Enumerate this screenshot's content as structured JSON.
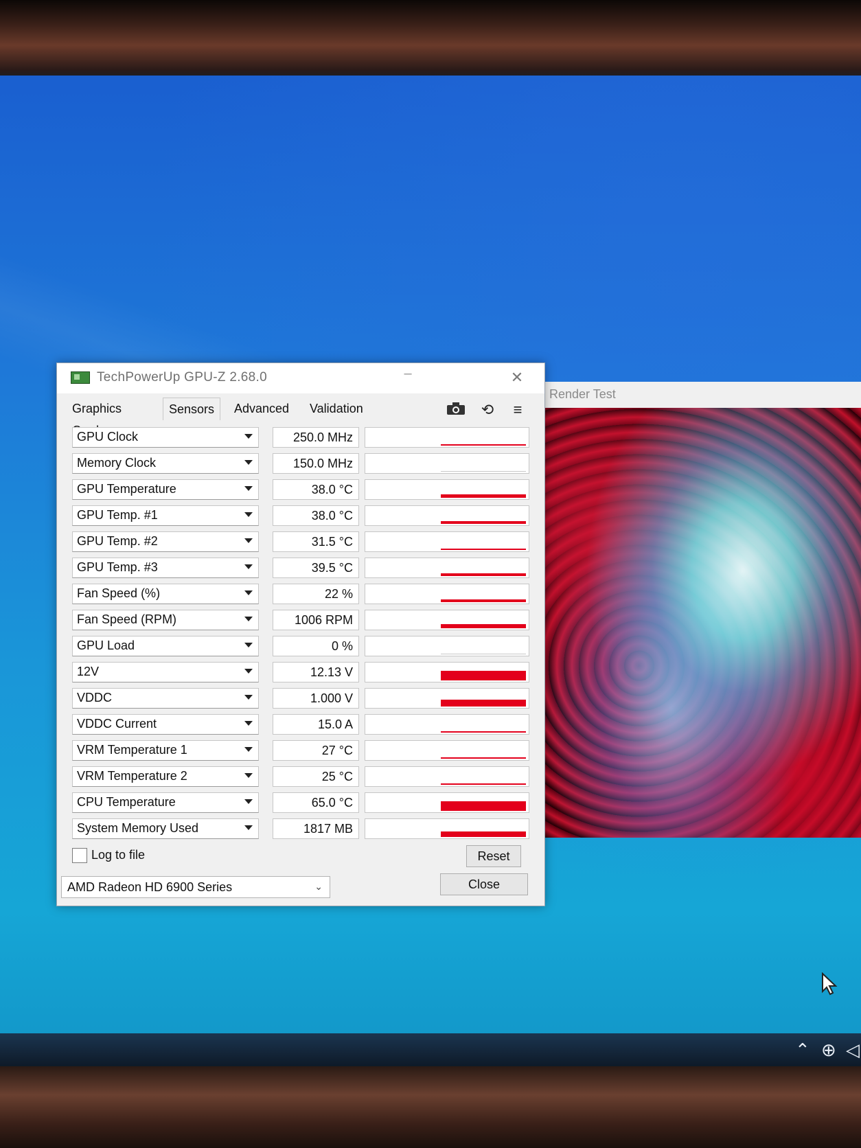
{
  "window": {
    "title": "TechPowerUp GPU-Z 2.68.0",
    "minimize_icon": "minimize-icon",
    "close_icon": "close-icon"
  },
  "tabs": [
    {
      "label": "Graphics Card",
      "active": false
    },
    {
      "label": "Sensors",
      "active": true
    },
    {
      "label": "Advanced",
      "active": false
    },
    {
      "label": "Validation",
      "active": false
    }
  ],
  "toolbar_icons": [
    "camera-icon",
    "refresh-icon",
    "menu-icon"
  ],
  "sensors": [
    {
      "name": "GPU Clock",
      "value": "250.0 MHz",
      "graph_level": 0.05
    },
    {
      "name": "Memory Clock",
      "value": "150.0 MHz",
      "graph_level": 0.0
    },
    {
      "name": "GPU Temperature",
      "value": "38.0 °C",
      "graph_level": 0.2
    },
    {
      "name": "GPU Temp. #1",
      "value": "38.0 °C",
      "graph_level": 0.15
    },
    {
      "name": "GPU Temp. #2",
      "value": "31.5 °C",
      "graph_level": 0.08
    },
    {
      "name": "GPU Temp. #3",
      "value": "39.5 °C",
      "graph_level": 0.15
    },
    {
      "name": "Fan Speed (%)",
      "value": "22 %",
      "graph_level": 0.15
    },
    {
      "name": "Fan Speed (RPM)",
      "value": "1006 RPM",
      "graph_level": 0.25
    },
    {
      "name": "GPU Load",
      "value": "0 %",
      "graph_level": 0.0
    },
    {
      "name": "12V",
      "value": "12.13 V",
      "graph_level": 0.6
    },
    {
      "name": "VDDC",
      "value": "1.000 V",
      "graph_level": 0.4
    },
    {
      "name": "VDDC Current",
      "value": "15.0 A",
      "graph_level": 0.1
    },
    {
      "name": "VRM Temperature 1",
      "value": "27 °C",
      "graph_level": 0.05
    },
    {
      "name": "VRM Temperature 2",
      "value": "25 °C",
      "graph_level": 0.05
    },
    {
      "name": "CPU Temperature",
      "value": "65.0 °C",
      "graph_level": 0.6
    },
    {
      "name": "System Memory Used",
      "value": "1817 MB",
      "graph_level": 0.35
    }
  ],
  "log_to_file": {
    "label": "Log to file",
    "checked": false
  },
  "buttons": {
    "reset": "Reset",
    "close": "Close"
  },
  "adapter": {
    "selected": "AMD Radeon HD 6900 Series"
  },
  "render_test": {
    "title": "Render Test"
  },
  "taskbar": {
    "tray_icons": [
      "chevron-up-icon",
      "network-icon",
      "volume-icon"
    ]
  },
  "colors": {
    "graph_red": "#e3001b",
    "desktop_blue": "#1a8ad8"
  }
}
